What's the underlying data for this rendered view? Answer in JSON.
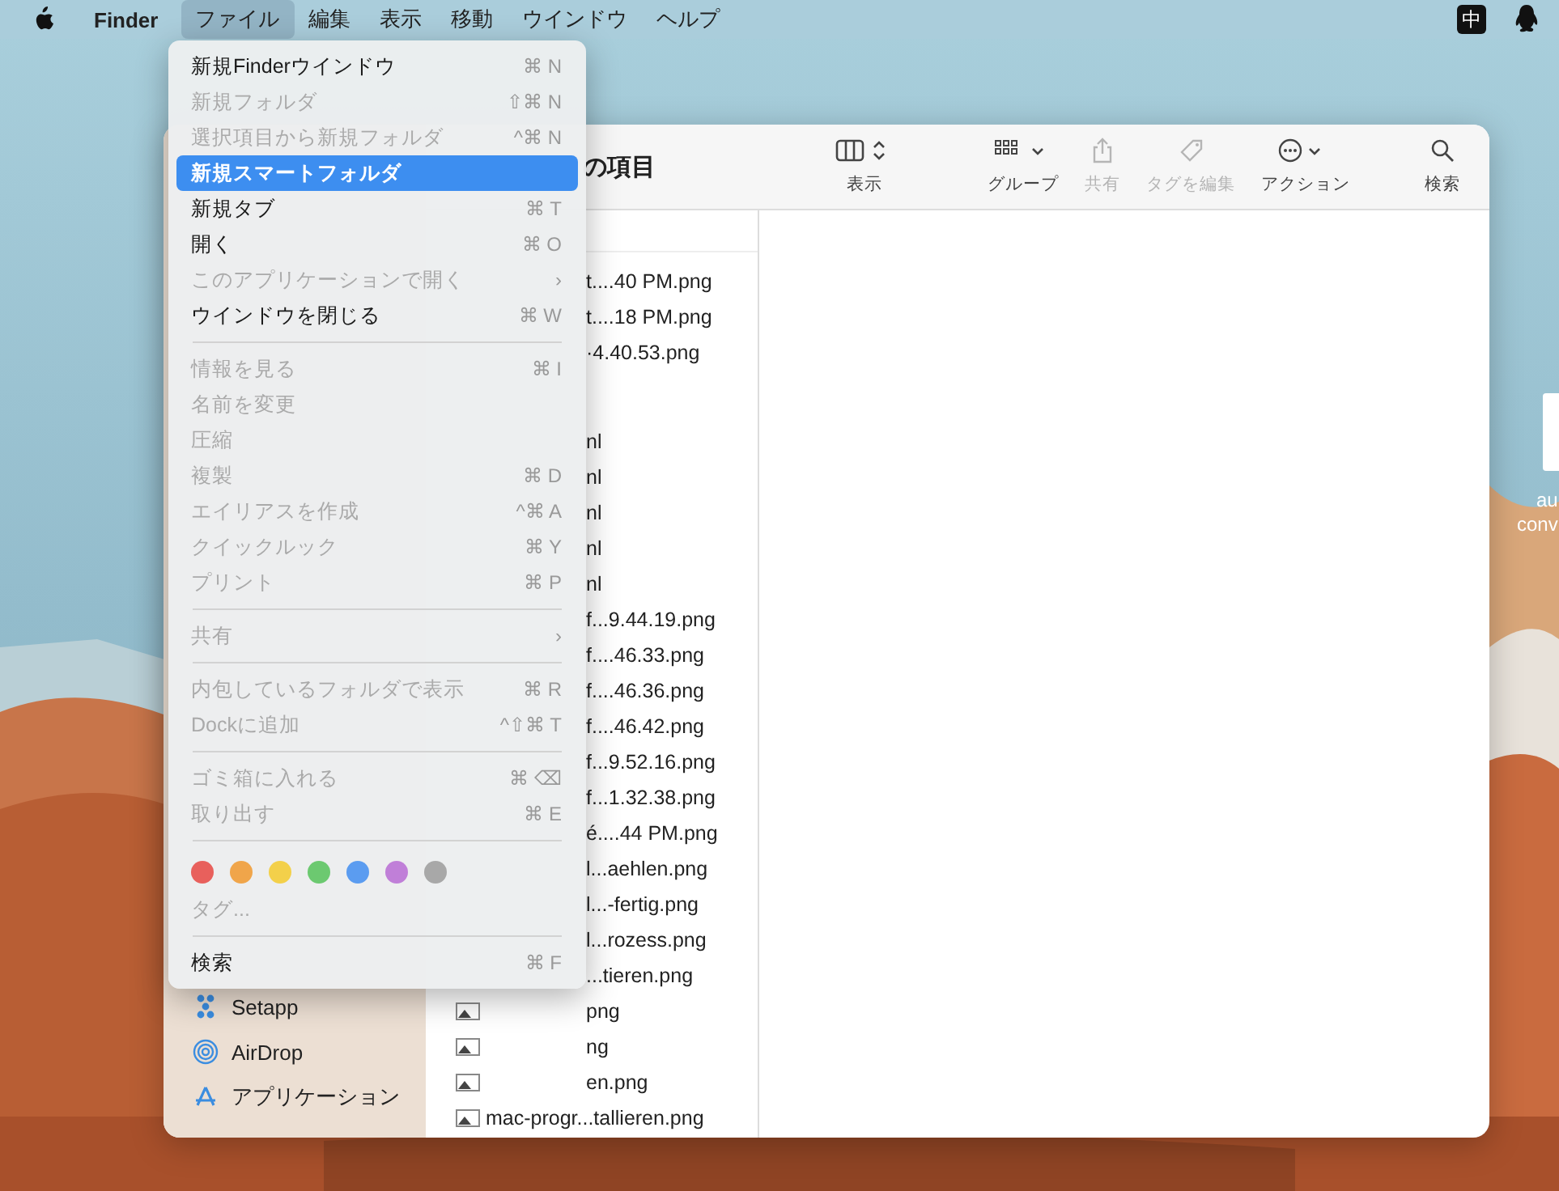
{
  "menu_bar": {
    "app": "Finder",
    "menus": [
      {
        "label": "ファイル",
        "selected": true
      },
      {
        "label": "編集",
        "selected": false
      },
      {
        "label": "表示",
        "selected": false
      },
      {
        "label": "移動",
        "selected": false
      },
      {
        "label": "ウインドウ",
        "selected": false
      },
      {
        "label": "ヘルプ",
        "selected": false
      }
    ],
    "input_method": "中"
  },
  "file_menu": [
    {
      "kind": "item",
      "label": "新規Finderウインドウ",
      "shortcut": "⌘ N",
      "disabled": false,
      "selected": false
    },
    {
      "kind": "item",
      "label": "新規フォルダ",
      "shortcut": "⇧⌘ N",
      "disabled": true,
      "selected": false
    },
    {
      "kind": "item",
      "label": "選択項目から新規フォルダ",
      "shortcut": "^⌘ N",
      "disabled": true,
      "selected": false
    },
    {
      "kind": "item",
      "label": "新規スマートフォルダ",
      "disabled": false,
      "selected": true
    },
    {
      "kind": "item",
      "label": "新規タブ",
      "shortcut": "⌘ T",
      "disabled": false,
      "selected": false
    },
    {
      "kind": "item",
      "label": "開く",
      "shortcut": "⌘ O",
      "disabled": false,
      "selected": false
    },
    {
      "kind": "item",
      "label": "このアプリケーションで開く",
      "shortcut": "›",
      "disabled": true,
      "selected": false
    },
    {
      "kind": "item",
      "label": "ウインドウを閉じる",
      "shortcut": "⌘ W",
      "disabled": false,
      "selected": false
    },
    {
      "kind": "separator"
    },
    {
      "kind": "item",
      "label": "情報を見る",
      "shortcut": "⌘ I",
      "disabled": true,
      "selected": false
    },
    {
      "kind": "item",
      "label": "名前を変更",
      "disabled": true,
      "selected": false
    },
    {
      "kind": "item",
      "label": "圧縮",
      "disabled": true,
      "selected": false
    },
    {
      "kind": "item",
      "label": "複製",
      "shortcut": "⌘ D",
      "disabled": true,
      "selected": false
    },
    {
      "kind": "item",
      "label": "エイリアスを作成",
      "shortcut": "^⌘ A",
      "disabled": true,
      "selected": false
    },
    {
      "kind": "item",
      "label": "クイックルック",
      "shortcut": "⌘ Y",
      "disabled": true,
      "selected": false
    },
    {
      "kind": "item",
      "label": "プリント",
      "shortcut": "⌘ P",
      "disabled": true,
      "selected": false
    },
    {
      "kind": "separator"
    },
    {
      "kind": "item",
      "label": "共有",
      "shortcut": "›",
      "disabled": true,
      "selected": false
    },
    {
      "kind": "separator"
    },
    {
      "kind": "item",
      "label": "内包しているフォルダで表示",
      "shortcut": "⌘ R",
      "disabled": true,
      "selected": false
    },
    {
      "kind": "item",
      "label": "Dockに追加",
      "shortcut": "^⇧⌘ T",
      "disabled": true,
      "selected": false
    },
    {
      "kind": "separator"
    },
    {
      "kind": "item",
      "label": "ゴミ箱に入れる",
      "shortcut": "⌘ ⌫",
      "disabled": true,
      "selected": false
    },
    {
      "kind": "item",
      "label": "取り出す",
      "shortcut": "⌘ E",
      "disabled": true,
      "selected": false
    },
    {
      "kind": "separator"
    },
    {
      "kind": "tags",
      "tags": [
        {
          "color": "#e8605c"
        },
        {
          "color": "#f0a54a"
        },
        {
          "color": "#f3d04a"
        },
        {
          "color": "#6cc970"
        },
        {
          "color": "#5b9cf0"
        },
        {
          "color": "#c07fd8"
        },
        {
          "color": "#a8a8a8"
        }
      ]
    },
    {
      "kind": "item",
      "label": "タグ...",
      "disabled": true,
      "selected": false
    },
    {
      "kind": "separator"
    },
    {
      "kind": "item",
      "label": "検索",
      "shortcut": "⌘ F",
      "disabled": false,
      "selected": false
    }
  ],
  "window": {
    "title": "の項目",
    "toolbar": [
      {
        "kind": "view",
        "label": "表示",
        "disabled": false
      },
      {
        "kind": "group",
        "label": "グループ",
        "disabled": false
      },
      {
        "kind": "share",
        "label": "共有",
        "disabled": true
      },
      {
        "kind": "tag",
        "label": "タグを編集",
        "disabled": true
      },
      {
        "kind": "action",
        "label": "アクション",
        "disabled": false
      },
      {
        "kind": "search",
        "label": "検索",
        "disabled": false
      }
    ],
    "sidebar": [
      {
        "kind": "setapp",
        "label": "Setapp"
      },
      {
        "kind": "airdrop",
        "label": "AirDrop"
      },
      {
        "kind": "apps",
        "label": "アプリケーション"
      }
    ],
    "files": [
      {
        "name": "t....40 PM.png"
      },
      {
        "name": "t....18 PM.png"
      },
      {
        "name": "·4.40.53.png"
      },
      {
        "name": "nl"
      },
      {
        "name": "nl"
      },
      {
        "name": "nl"
      },
      {
        "name": "nl"
      },
      {
        "name": "nl"
      },
      {
        "name": "f...9.44.19.png"
      },
      {
        "name": "f....46.33.png"
      },
      {
        "name": "f....46.36.png"
      },
      {
        "name": "f....46.42.png"
      },
      {
        "name": "f...9.52.16.png"
      },
      {
        "name": "f...1.32.38.png"
      },
      {
        "name": "é....44 PM.png"
      },
      {
        "name": "l...aehlen.png"
      },
      {
        "name": "l...-fertig.png"
      },
      {
        "name": "l...rozess.png"
      },
      {
        "name": "...tieren.png"
      },
      {
        "name": "png",
        "icon": true
      },
      {
        "name": "ng",
        "icon": true
      },
      {
        "name": "en.png",
        "icon": true
      },
      {
        "name": "mac-progr...tallieren.png",
        "icon": true
      }
    ]
  },
  "desktop_icon": {
    "label_lines": [
      "au",
      "conv"
    ]
  }
}
